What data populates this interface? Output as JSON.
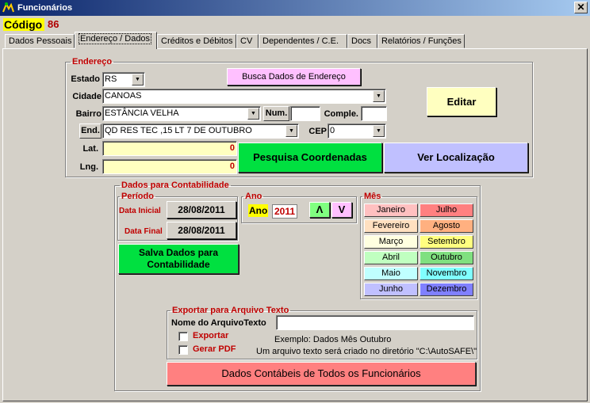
{
  "window": {
    "title": "Funcionários",
    "close": "✕"
  },
  "header": {
    "code_label": "Código",
    "code_value": "86"
  },
  "tabs": [
    "Dados Pessoais",
    "Endereço / Dados",
    "Créditos e Débitos",
    "CV",
    "Dependentes / C.E.",
    "Docs",
    "Relatórios / Funções"
  ],
  "endereco": {
    "legend": "Endereço",
    "estado_label": "Estado",
    "estado_value": "RS",
    "busca_button": "Busca Dados de Endereço",
    "cidade_label": "Cidade",
    "cidade_value": "CANOAS",
    "bairro_label": "Bairro",
    "bairro_value": "ESTÂNCIA VELHA",
    "num_label": "Num.",
    "num_value": "",
    "comple_label": "Comple.",
    "comple_value": "",
    "end_label": "End.",
    "end_value": "QD RES TEC ,15 LT 7 DE OUTUBRO",
    "cep_label": "CEP",
    "cep_value": "0",
    "lat_label": "Lat.",
    "lat_value": "0",
    "lng_label": "Lng.",
    "lng_value": "0",
    "editar_button": "Editar",
    "pesquisa_button": "Pesquisa Coordenadas",
    "ver_button": "Ver Localização"
  },
  "contabilidade": {
    "legend": "Dados para Contabilidade",
    "periodo": {
      "legend": "Período",
      "inicial_label": "Data Inicial",
      "inicial_value": "28/08/2011",
      "final_label": "Data Final",
      "final_value": "28/08/2011"
    },
    "salva_button": "Salva Dados para Contabilidade",
    "ano": {
      "legend": "Ano",
      "label": "Ano",
      "value": "2011",
      "up": "Λ",
      "down": "V"
    },
    "mes": {
      "legend": "Mês",
      "months": [
        "Janeiro",
        "Julho",
        "Fevereiro",
        "Agosto",
        "Março",
        "Setembro",
        "Abril",
        "Outubro",
        "Maio",
        "Novembro",
        "Junho",
        "Dezembro"
      ]
    },
    "exportar": {
      "legend": "Exportar para Arquivo Texto",
      "nome_label": "Nome do ArquivoTexto",
      "nome_value": "",
      "exportar_label": "Exportar",
      "pdf_label": "Gerar PDF",
      "exemplo": "Exemplo: Dados Mês Outubro",
      "info": "Um arquivo texto será criado no diretório \"C:\\AutoSAFE\\\""
    },
    "todos_button": "Dados Contábeis de Todos os Funcionários"
  },
  "colors": {
    "titlebar": "#0a246a",
    "code_bg": "#ffff00",
    "legend": "#c00000",
    "busca": "#ffc0ff",
    "editar": "#ffffc0",
    "pesquisa": "#00e040",
    "ver": "#c0c0ff",
    "salva": "#00e040",
    "todos": "#ff8080"
  }
}
